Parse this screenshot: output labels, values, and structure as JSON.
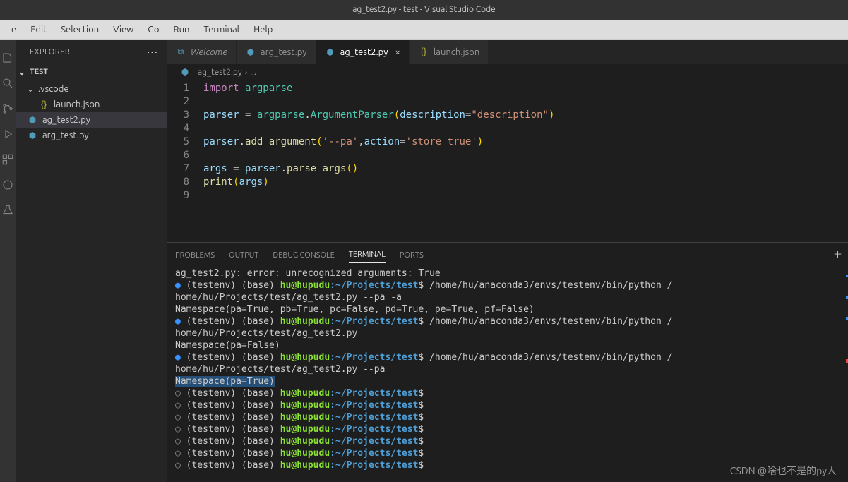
{
  "title": "ag_test2.py - test - Visual Studio Code",
  "menu": [
    "e",
    "Edit",
    "Selection",
    "View",
    "Go",
    "Run",
    "Terminal",
    "Help"
  ],
  "sidebar": {
    "title": "EXPLORER",
    "section": "TEST",
    "items": [
      {
        "label": ".vscode",
        "type": "folder",
        "indent": 0,
        "expanded": true
      },
      {
        "label": "launch.json",
        "type": "json",
        "indent": 1
      },
      {
        "label": "ag_test2.py",
        "type": "python",
        "indent": 0,
        "selected": true
      },
      {
        "label": "arg_test.py",
        "type": "python",
        "indent": 0
      }
    ]
  },
  "tabs": [
    {
      "label": "Welcome",
      "type": "welcome"
    },
    {
      "label": "arg_test.py",
      "type": "python"
    },
    {
      "label": "ag_test2.py",
      "type": "python",
      "active": true,
      "close": true
    },
    {
      "label": "launch.json",
      "type": "json"
    }
  ],
  "breadcrumb": {
    "file": "ag_test2.py",
    "sep": "›",
    "more": "..."
  },
  "code": {
    "lineStart": 1,
    "lineEnd": 9
  },
  "panels": {
    "tabs": [
      "PROBLEMS",
      "OUTPUT",
      "DEBUG CONSOLE",
      "TERMINAL",
      "PORTS"
    ],
    "active": "TERMINAL"
  },
  "terminal": {
    "error": "ag_test2.py: error: unrecognized arguments: True",
    "promptEnv": "(testenv) (base) ",
    "promptUser": "hu@hupudu",
    "promptSep": ":",
    "promptPath": "~/Projects/test",
    "promptEnd": "$",
    "cmd1": " /home/hu/anaconda3/envs/testenv/bin/python /",
    "cmd1b": "home/hu/Projects/test/ag_test2.py --pa -a",
    "out1": "Namespace(pa=True, pb=True, pc=False, pd=True, pe=True, pf=False)",
    "cmd2b": "home/hu/Projects/test/ag_test2.py",
    "out2": "Namespace(pa=False)",
    "cmd3b": "home/hu/Projects/test/ag_test2.py --pa",
    "out3": "Namespace(pa=True)"
  },
  "watermark": "CSDN @啥也不是的py人"
}
